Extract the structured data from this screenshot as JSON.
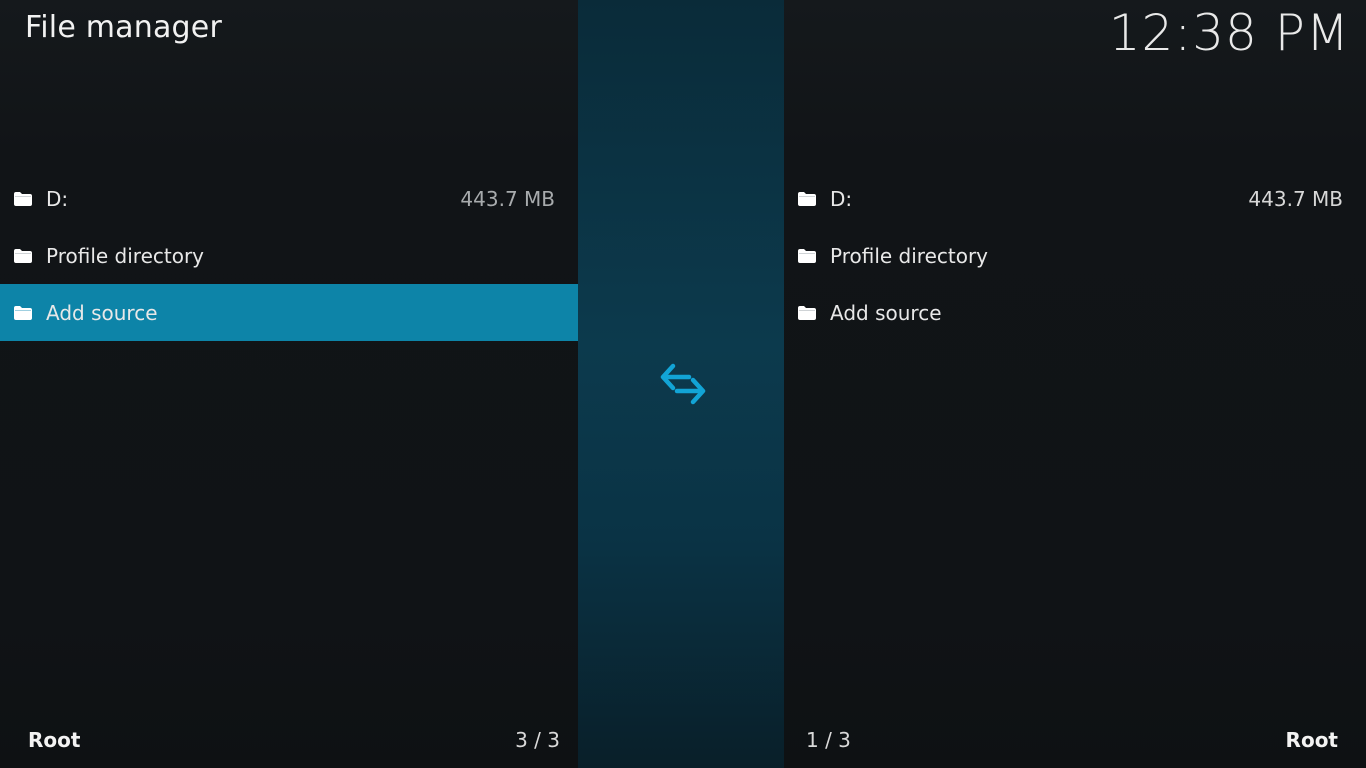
{
  "header": {
    "title": "File manager",
    "clock": "12:38 PM"
  },
  "left_pane": {
    "items": [
      {
        "label": "D:",
        "size": "443.7 MB",
        "icon": "folder-icon"
      },
      {
        "label": "Profile directory",
        "size": "",
        "icon": "folder-icon"
      },
      {
        "label": "Add source",
        "size": "",
        "icon": "folder-icon"
      }
    ],
    "focused_index": 2,
    "path_label": "Root",
    "count": "3 / 3"
  },
  "right_pane": {
    "items": [
      {
        "label": "D:",
        "size": "443.7 MB",
        "icon": "folder-icon"
      },
      {
        "label": "Profile directory",
        "size": "",
        "icon": "folder-icon"
      },
      {
        "label": "Add source",
        "size": "",
        "icon": "folder-icon"
      }
    ],
    "path_label": "Root",
    "count": "1 / 3"
  },
  "center": {
    "icon": "swap-arrows-icon"
  },
  "colors": {
    "focus": "#0d84a8",
    "accent": "#12a4d6"
  }
}
